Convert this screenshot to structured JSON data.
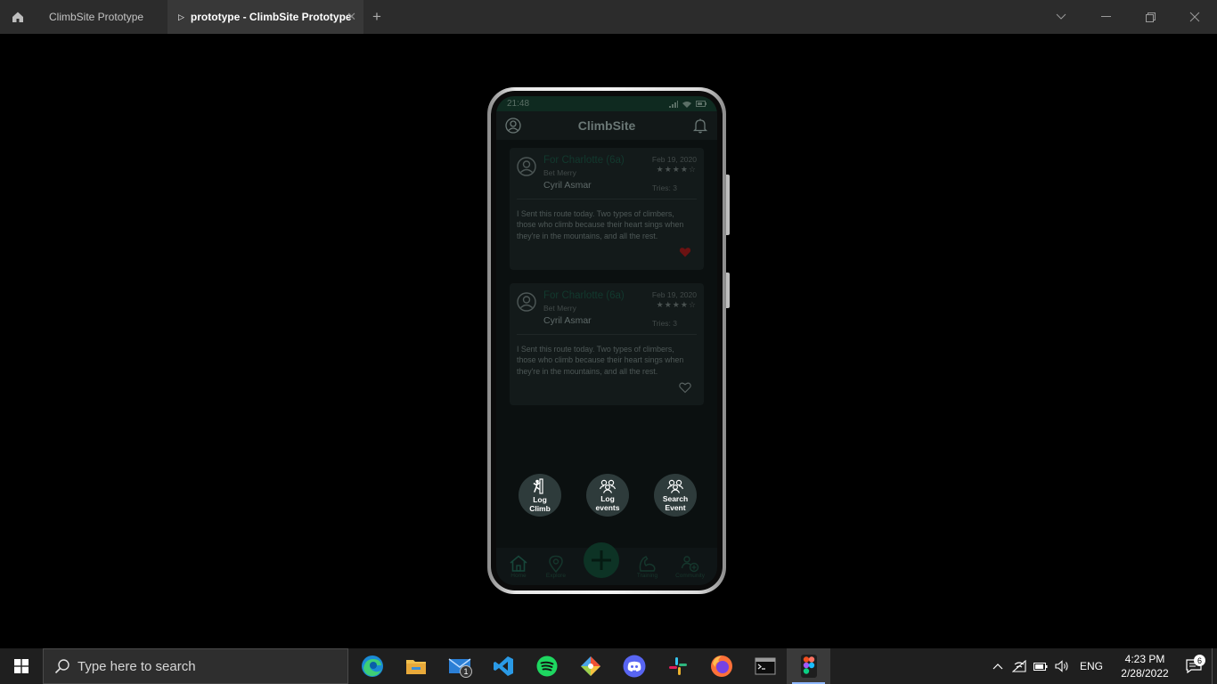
{
  "titlebar": {
    "tabs": [
      {
        "label": "ClimbSite Prototype"
      },
      {
        "label": "prototype - ClimbSite Prototype"
      }
    ]
  },
  "phone": {
    "status_time": "21:48",
    "app_title": "ClimbSite",
    "posts": [
      {
        "route": "For Charlotte (6a)",
        "gym": "Bet Merry",
        "user": "Cyril Asmar",
        "date": "Feb 19, 2020",
        "rating": 4,
        "tries": "Tries: 3",
        "text": "I Sent this route today. Two types of climbers, those who climb because their heart sings when they're in the mountains, and all the rest.",
        "liked": true
      },
      {
        "route": "For Charlotte (6a)",
        "gym": "Bet Merry",
        "user": "Cyril Asmar",
        "date": "Feb 19, 2020",
        "rating": 4,
        "tries": "Tries: 3",
        "text": "I Sent this route today. Two types of climbers, those who climb because their heart sings when they're in the mountains, and all the rest.",
        "liked": false
      }
    ],
    "fab_actions": [
      {
        "label1": "Log",
        "label2": "Climb",
        "icon": "climber-icon"
      },
      {
        "label1": "Log",
        "label2": "events",
        "icon": "group-icon"
      },
      {
        "label1": "Search",
        "label2": "Event",
        "icon": "group-icon"
      }
    ],
    "nav": {
      "home": "Home",
      "explore": "Explore",
      "training": "Training",
      "community": "Community"
    }
  },
  "taskbar": {
    "search_placeholder": "Type here to search",
    "mail_badge": "1",
    "language": "ENG",
    "time": "4:23 PM",
    "date": "2/28/2022",
    "notifications": "6"
  },
  "colors": {
    "accent_green": "#0d3325",
    "like_red": "#6b1212"
  }
}
